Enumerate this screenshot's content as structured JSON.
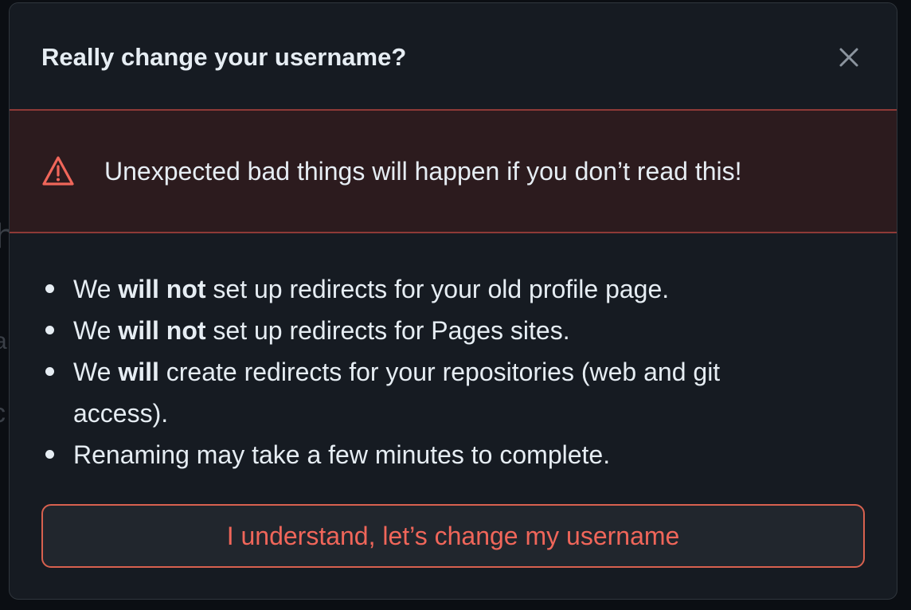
{
  "dialog": {
    "title": "Really change your username?",
    "close_icon": "close-icon"
  },
  "flash": {
    "icon": "alert-triangle-icon",
    "message": "Unexpected bad things will happen if you don’t read this!"
  },
  "notes": [
    {
      "prefix": "We ",
      "emphasis": "will not",
      "suffix": " set up redirects for your old profile page."
    },
    {
      "prefix": "We ",
      "emphasis": "will not",
      "suffix": " set up redirects for Pages sites."
    },
    {
      "prefix": "We ",
      "emphasis": "will",
      "suffix": " create redirects for your repositories (web and git access)."
    },
    {
      "prefix": "",
      "emphasis": "",
      "suffix": "Renaming may take a few minutes to complete."
    }
  ],
  "confirm_button": {
    "label": "I understand, let’s change my username"
  },
  "colors": {
    "danger": "#f0665a",
    "danger_border": "#8e3a37",
    "flash_bg": "#2c1b1e",
    "dialog_bg": "#161b22",
    "text": "#e6edf3"
  }
}
